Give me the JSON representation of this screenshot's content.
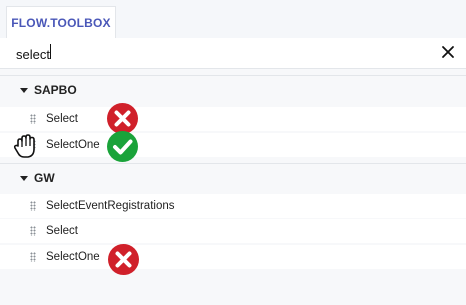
{
  "tab": {
    "label": "FLOW.TOOLBOX"
  },
  "search": {
    "value": "select"
  },
  "groups": [
    {
      "label": "SAPBO",
      "items": [
        {
          "label": "Select",
          "status": "reject"
        },
        {
          "label": "SelectOne",
          "status": "accept"
        }
      ]
    },
    {
      "label": "GW",
      "items": [
        {
          "label": "SelectEventRegistrations",
          "status": ""
        },
        {
          "label": "Select",
          "status": ""
        },
        {
          "label": "SelectOne",
          "status": "reject"
        }
      ]
    }
  ],
  "colors": {
    "accent": "#4a57b8",
    "reject": "#d0202a",
    "accept": "#1aa33a"
  },
  "icons": {
    "clear": "close-icon",
    "reject": "x-circle-icon",
    "accept": "check-circle-icon",
    "cursor": "grab-hand-cursor-icon"
  }
}
